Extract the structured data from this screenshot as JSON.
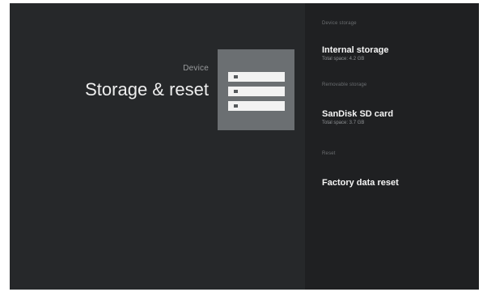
{
  "header": {
    "breadcrumb": "Device",
    "title": "Storage & reset"
  },
  "hero_icon": "storage-drives-icon",
  "settings": {
    "device_storage": {
      "header": "Device storage",
      "internal": {
        "title": "Internal storage",
        "subtitle": "Total space: 4.2 GB"
      }
    },
    "removable_storage": {
      "header": "Removable storage",
      "sdcard": {
        "title": "SanDisk SD card",
        "subtitle": "Total space: 3.7 GB"
      }
    },
    "reset": {
      "header": "Reset",
      "factory": {
        "title": "Factory data reset"
      }
    }
  },
  "colors": {
    "background": "#26282a",
    "panel": "#1f2022",
    "tile": "#6b6f72"
  }
}
